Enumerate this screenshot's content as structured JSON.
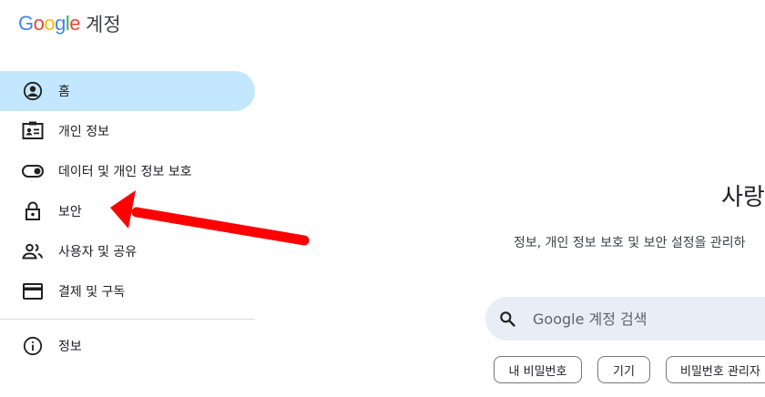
{
  "header": {
    "logo_letters": [
      {
        "char": "G",
        "color": "#4285F4"
      },
      {
        "char": "o",
        "color": "#EA4335"
      },
      {
        "char": "o",
        "color": "#FBBC05"
      },
      {
        "char": "g",
        "color": "#4285F4"
      },
      {
        "char": "l",
        "color": "#34A853"
      },
      {
        "char": "e",
        "color": "#EA4335"
      }
    ],
    "logo_suffix": "계정"
  },
  "sidebar": {
    "items": [
      {
        "label": "홈",
        "icon": "account-circle-icon",
        "active": true
      },
      {
        "label": "개인 정보",
        "icon": "id-card-icon"
      },
      {
        "label": "데이터 및 개인 정보 보호",
        "icon": "toggle-icon"
      },
      {
        "label": "보안",
        "icon": "lock-icon"
      },
      {
        "label": "사용자 및 공유",
        "icon": "people-icon"
      },
      {
        "label": "결제 및 구독",
        "icon": "credit-card-icon"
      }
    ],
    "info": {
      "label": "정보",
      "icon": "info-icon"
    }
  },
  "main": {
    "welcome_partial": "사랑",
    "subtitle": "정보, 개인 정보 보호 및 보안 설정을 관리하",
    "search": {
      "placeholder": "Google 계정 검색",
      "icon": "search-icon"
    },
    "chips": [
      "내 비밀번호",
      "기기",
      "비밀번호 관리자"
    ]
  },
  "colors": {
    "active_bg": "#c2e7ff",
    "arrow": "#ff0000",
    "search_bg": "#e9eef6"
  }
}
